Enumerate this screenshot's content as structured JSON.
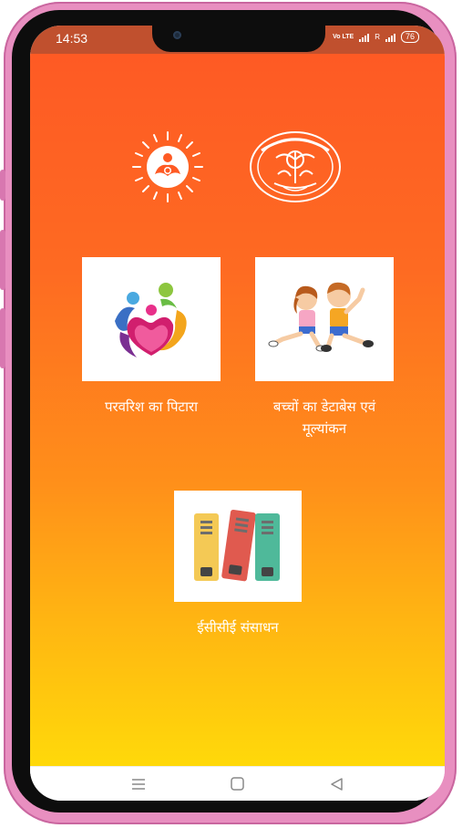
{
  "status_bar": {
    "time": "14:53",
    "network": "Vo LTE",
    "sim2": "R",
    "battery": "76"
  },
  "app": {
    "logos": [
      "icds-sun-logo",
      "up-government-emblem"
    ],
    "tiles": [
      {
        "label": "परवरिश का पिटारा",
        "icon": "family-heart-icon"
      },
      {
        "label_line1": "बच्चों का  डेटाबेस एवं",
        "label_line2": "मूल्यांकन",
        "icon": "children-playing-icon"
      },
      {
        "label": "ईसीसीई संसाधन",
        "icon": "binders-icon"
      }
    ]
  },
  "nav_bar": {
    "recent_icon": "menu-icon",
    "home_icon": "home-square-icon",
    "back_icon": "back-triangle-icon"
  },
  "colors": {
    "gradient_top": "#fe5a24",
    "gradient_bottom": "#ffd90a",
    "status_bar": "#c0502e",
    "phone_case": "#e88fc0"
  }
}
